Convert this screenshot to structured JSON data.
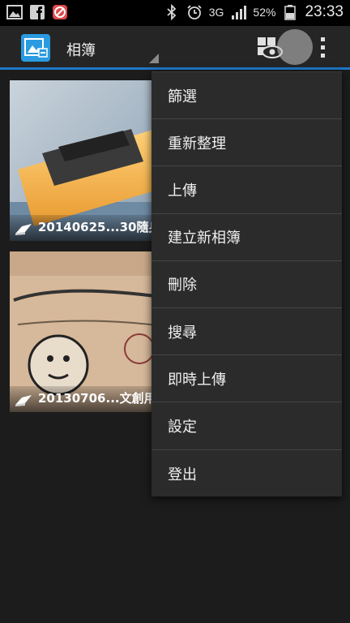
{
  "status_bar": {
    "icons_left": [
      "gallery-icon",
      "facebook-icon",
      "app-badge-icon"
    ],
    "icons_right": [
      "bluetooth-icon",
      "alarm-icon",
      "3g-icon",
      "signal-icon",
      "battery-icon"
    ],
    "network_type": "3G",
    "battery_percent": "52%",
    "time": "23:33"
  },
  "action_bar": {
    "title": "相簿",
    "accent_color": "#1e78c8"
  },
  "albums": [
    {
      "label": "20140625...30隨身"
    },
    {
      "label": "20130706...文創用"
    }
  ],
  "menu": {
    "items": [
      {
        "label": "篩選"
      },
      {
        "label": "重新整理"
      },
      {
        "label": "上傳"
      },
      {
        "label": "建立新相簿"
      },
      {
        "label": "刪除"
      },
      {
        "label": "搜尋"
      },
      {
        "label": "即時上傳"
      },
      {
        "label": "設定"
      },
      {
        "label": "登出"
      }
    ]
  }
}
